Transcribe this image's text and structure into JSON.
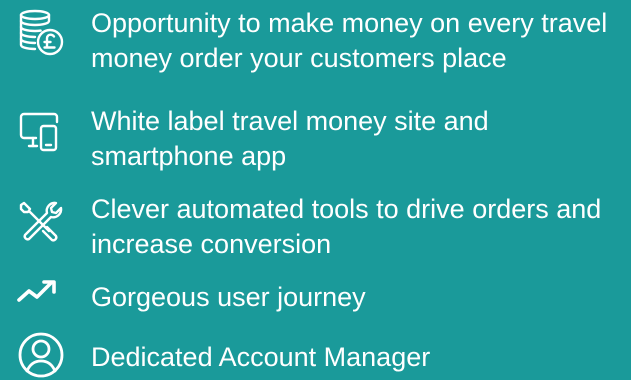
{
  "theme": {
    "background": "#1a9a9a",
    "foreground": "#ffffff"
  },
  "features": [
    {
      "icon": "coins-pound-icon",
      "text": "Opportunity to make money on every travel money order your customers place"
    },
    {
      "icon": "devices-icon",
      "text": "White label travel money site and smartphone app"
    },
    {
      "icon": "tools-icon",
      "text": "Clever automated tools to drive orders and increase conversion"
    },
    {
      "icon": "trending-up-icon",
      "text": "Gorgeous user journey"
    },
    {
      "icon": "user-circle-icon",
      "text": "Dedicated Account Manager"
    }
  ]
}
